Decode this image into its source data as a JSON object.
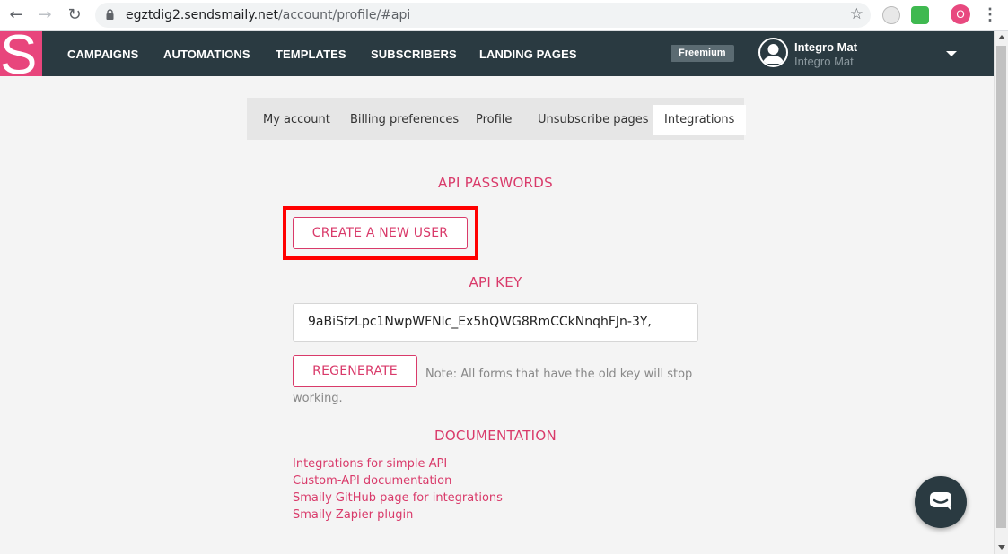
{
  "browser": {
    "url_host": "egztdig2.sendsmaily.net",
    "url_path": "/account/profile/#api",
    "profile_initial": "O"
  },
  "app": {
    "logo_letter": "S",
    "nav": [
      "CAMPAIGNS",
      "AUTOMATIONS",
      "TEMPLATES",
      "SUBSCRIBERS",
      "LANDING PAGES"
    ],
    "plan_badge": "Freemium",
    "user_name": "Integro Mat",
    "user_sub": "Integro Mat"
  },
  "tabs": [
    "My account",
    "Billing preferences",
    "Profile",
    "Unsubscribe pages",
    "Integrations"
  ],
  "api_passwords": {
    "title": "API PASSWORDS",
    "create_button": "CREATE A NEW USER"
  },
  "api_key": {
    "title": "API KEY",
    "value": "9aBiSfzLpc1NwpWFNlc_Ex5hQWG8RmCCkNnqhFJn-3Y,",
    "regenerate_button": "REGENERATE",
    "note": "Note: All forms that have the old key will stop working."
  },
  "documentation": {
    "title": "DOCUMENTATION",
    "links": [
      "Integrations for simple API",
      "Custom-API documentation",
      "Smaily GitHub page for integrations",
      "Smaily Zapier plugin"
    ]
  },
  "colors": {
    "accent": "#d93a6a",
    "brand": "#e8457c",
    "navbar": "#2a3a41",
    "highlight": "#ff0000"
  }
}
